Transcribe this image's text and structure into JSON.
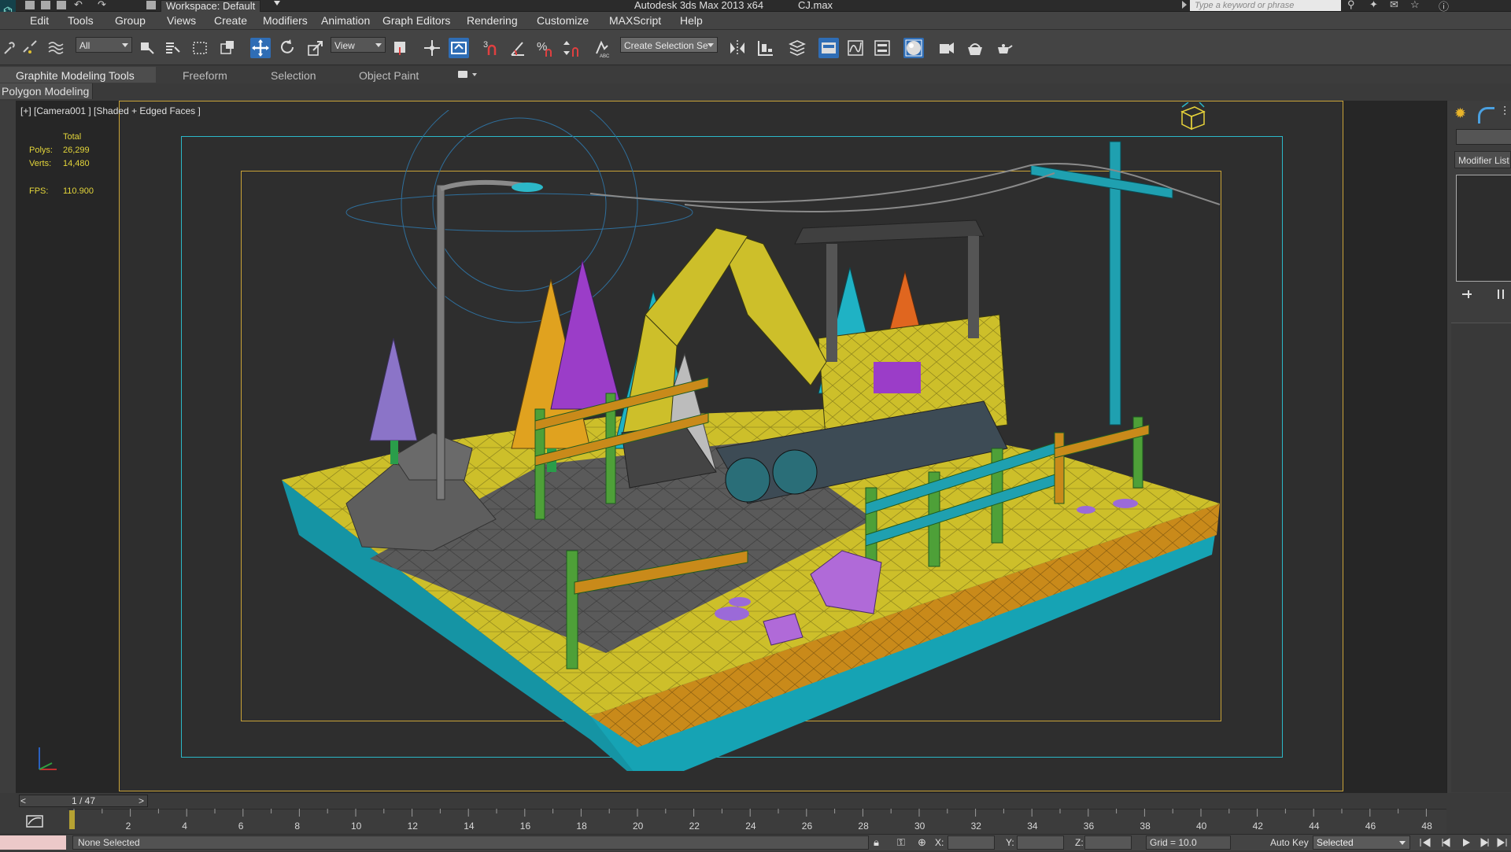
{
  "titlebar": {
    "workspace_label": "Workspace: Default",
    "app_title": "Autodesk 3ds Max  2013 x64",
    "file_name": "CJ.max",
    "search_placeholder": "Type a keyword or phrase"
  },
  "menu": [
    "Edit",
    "Tools",
    "Group",
    "Views",
    "Create",
    "Modifiers",
    "Animation",
    "Graph Editors",
    "Rendering",
    "Customize",
    "MAXScript",
    "Help"
  ],
  "toolbar": {
    "selection_filter": "All",
    "ref_coord": "View",
    "named_selection_placeholder": "Create Selection Se",
    "snap_label": "3",
    "active_tool": "select-and-move"
  },
  "ribbon": {
    "tabs": [
      "Graphite Modeling Tools",
      "Freeform",
      "Selection",
      "Object Paint"
    ],
    "panel": "Polygon Modeling"
  },
  "viewport": {
    "label": "[+] [Camera001 ] [Shaded + Edged Faces ]",
    "stats_header": "Total",
    "polys_label": "Polys:",
    "polys_value": "26,299",
    "verts_label": "Verts:",
    "verts_value": "14,480",
    "fps_label": "FPS:",
    "fps_value": "110.900"
  },
  "command_panel": {
    "modifier_list": "Modifier List"
  },
  "timeline": {
    "frame_display": "1 / 47",
    "prev": "<",
    "next": ">",
    "ticks": [
      "2",
      "4",
      "6",
      "8",
      "10",
      "12",
      "14",
      "16",
      "18",
      "20",
      "22",
      "24",
      "26",
      "28",
      "30",
      "32",
      "34",
      "36",
      "38",
      "40",
      "42",
      "44",
      "46",
      "48"
    ]
  },
  "status": {
    "selection": "None Selected",
    "x_label": "X:",
    "y_label": "Y:",
    "z_label": "Z:",
    "grid": "Grid = 10.0",
    "auto_key": "Auto Key",
    "set_key_mode": "Selected"
  },
  "colors": {
    "accent_blue": "#2f6db5",
    "safe_frame": "#2bb8c8",
    "live_frame": "#c9a338",
    "stat_text": "#e3d53a",
    "terrain_yellow": "#cdbf2a",
    "terrain_cyan": "#16a3b4"
  }
}
